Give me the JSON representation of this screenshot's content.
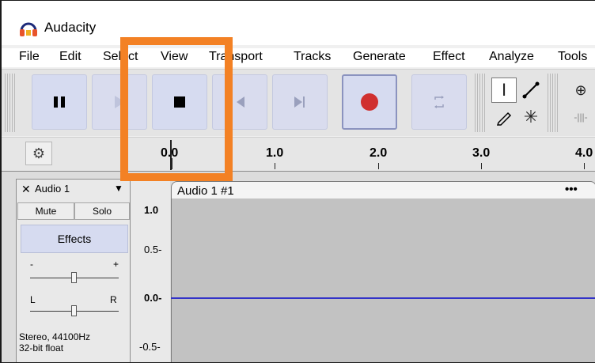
{
  "window": {
    "title": "Audacity",
    "app_icon": "headphones-icon"
  },
  "menu": [
    "File",
    "Edit",
    "Select",
    "View",
    "Transport",
    "Tracks",
    "Generate",
    "Effect",
    "Analyze",
    "Tools"
  ],
  "transport": {
    "pause": "pause-icon",
    "play": "play-icon",
    "stop": "stop-icon",
    "skip_start": "skip-to-start-icon",
    "skip_end": "skip-to-end-icon",
    "record": "record-icon",
    "loop": "loop-icon"
  },
  "tools": {
    "selection": "selection-tool-icon",
    "envelope": "envelope-tool-icon",
    "draw": "draw-tool-icon",
    "multi": "multi-tool-icon",
    "zoom_in": "zoom-in-icon",
    "trim": "trim-icon"
  },
  "timeline": {
    "labels": [
      "0.0",
      "1.0",
      "2.0",
      "3.0",
      "4.0"
    ]
  },
  "track": {
    "close_symbol": "✕",
    "name": "Audio 1",
    "mute_label": "Mute",
    "solo_label": "Solo",
    "effects_label": "Effects",
    "gain_minus": "-",
    "gain_plus": "+",
    "pan_left": "L",
    "pan_right": "R",
    "format_line1": "Stereo, 44100Hz",
    "format_line2": "32-bit float"
  },
  "vertical_ruler": [
    "1.0",
    "0.5-",
    "0.0-",
    "-0.5-"
  ],
  "clip": {
    "title": "Audio 1 #1",
    "menu_symbol": "•••"
  },
  "colors": {
    "accent_highlight": "#F38124",
    "waveform": "#3232C8",
    "record": "#D03030",
    "button": "#D6DBF0"
  }
}
